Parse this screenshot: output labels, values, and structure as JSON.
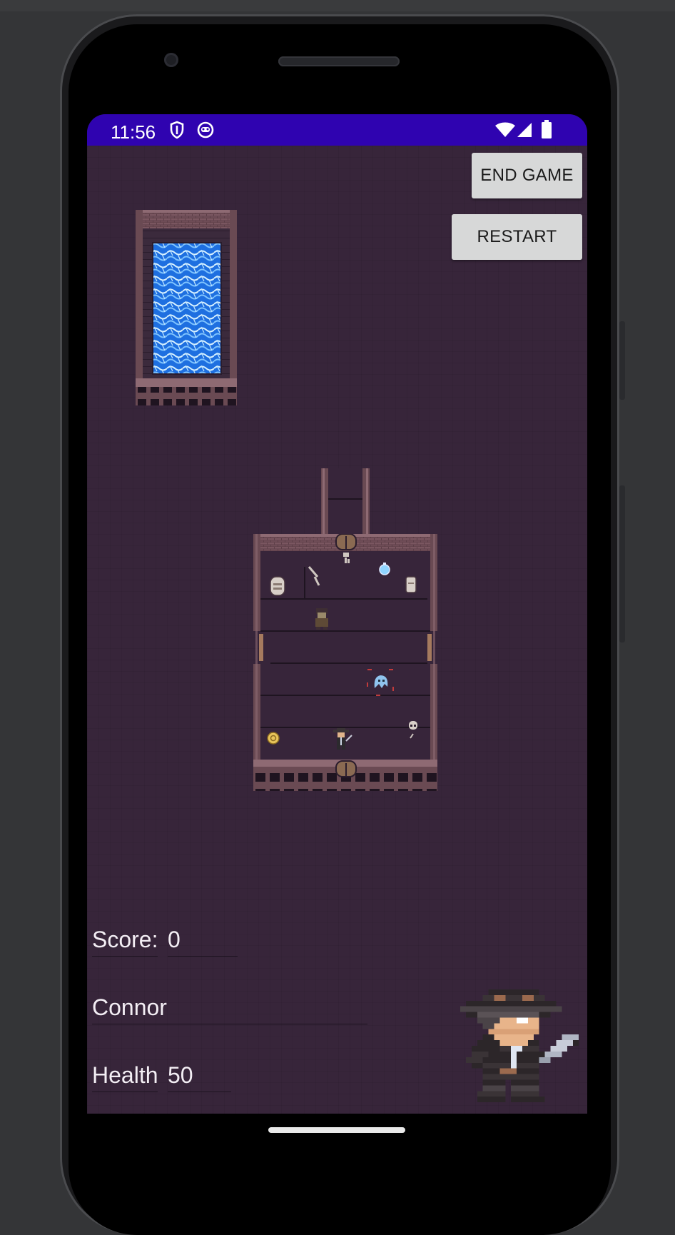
{
  "status_bar": {
    "time": "11:56",
    "left_icons": [
      "shield-icon",
      "face-icon"
    ],
    "right_icons": [
      "wifi-icon",
      "signal-icon",
      "battery-icon"
    ]
  },
  "buttons": {
    "end_game": "END GAME",
    "restart": "RESTART"
  },
  "hud": {
    "score_label": "Score:",
    "score_value": "0",
    "player_name": "Connor",
    "health_label": "Health",
    "health_value": "50"
  },
  "colors": {
    "status_bar": "#2f03b0",
    "game_background": "#37253a",
    "button": "#d7d8d8",
    "hud_text": "#f3eef4"
  }
}
